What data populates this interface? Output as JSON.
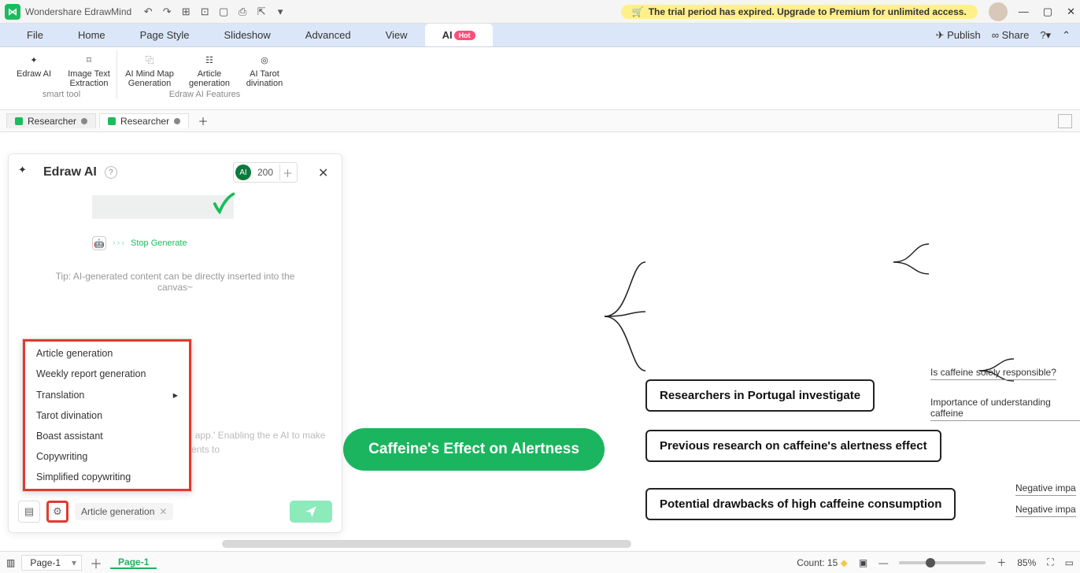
{
  "app": {
    "title": "Wondershare EdrawMind"
  },
  "trial_banner": "The trial period has expired. Upgrade to Premium for unlimited access.",
  "menu": {
    "items": [
      "File",
      "Home",
      "Page Style",
      "Slideshow",
      "Advanced",
      "View"
    ],
    "ai_label": "AI",
    "hot": "Hot",
    "publish": "Publish",
    "share": "Share"
  },
  "ribbon": {
    "smart_tool": {
      "label": "smart tool",
      "items": [
        {
          "label": "Edraw AI"
        },
        {
          "label": "Image Text Extraction"
        }
      ]
    },
    "edraw_ai": {
      "label": "Edraw AI Features",
      "items": [
        {
          "label": "AI Mind Map Generation"
        },
        {
          "label": "Article generation"
        },
        {
          "label": "AI Tarot divination"
        }
      ]
    }
  },
  "tabs": [
    {
      "label": "Researcher"
    },
    {
      "label": "Researcher"
    }
  ],
  "ai_panel": {
    "title": "Edraw AI",
    "credits": "200",
    "stop": "Stop Generate",
    "tip": "Tip: AI-generated content can be directly inserted into the canvas~",
    "hint": "bout the app.' Enabling the e AI to make adjustments to",
    "chip": "Article generation",
    "menu": [
      "Article generation",
      "Weekly report generation",
      "Translation",
      "Tarot divination",
      "Boast assistant",
      "Copywriting",
      "Simplified copywriting"
    ]
  },
  "mindmap": {
    "root": "Caffeine's Effect on Alertness",
    "n1": "Researchers in Portugal investigate",
    "n2": "Previous research on caffeine's alertness effect",
    "n3": "Potential drawbacks of high caffeine consumption",
    "leaf1": "Is caffeine solely responsible?",
    "leaf2": "Importance of understanding caffeine",
    "leaf3": "Negative impa",
    "leaf4": "Negative impa"
  },
  "status": {
    "count_label": "Count:",
    "count_value": "15",
    "zoom": "85%",
    "page_sel": "Page-1",
    "page_tab": "Page-1"
  }
}
